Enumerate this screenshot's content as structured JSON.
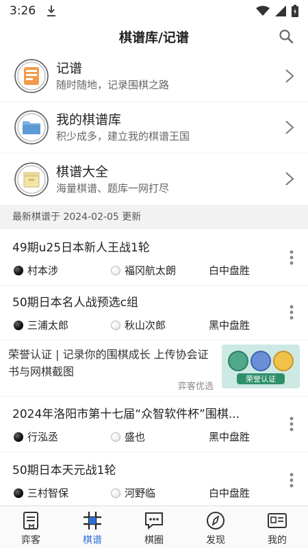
{
  "status_bar": {
    "time": "3:26"
  },
  "header": {
    "title": "棋谱库/记谱"
  },
  "menu": [
    {
      "title": "记谱",
      "subtitle": "随时随地，记录围棋之路"
    },
    {
      "title": "我的棋谱库",
      "subtitle": "积少成多，建立我的棋谱王国"
    },
    {
      "title": "棋谱大全",
      "subtitle": "海量棋谱、题库一网打尽"
    }
  ],
  "section": {
    "header": "最新棋谱于 2024-02-05 更新"
  },
  "games": [
    {
      "title": "49期u25日本新人王战1轮",
      "black": "村本涉",
      "white": "福冈航太朗",
      "result": "白中盘胜"
    },
    {
      "title": "50期日本名人战预选c组",
      "black": "三浦太郎",
      "white": "秋山次郎",
      "result": "黑中盘胜"
    },
    {
      "title": "2024年洛阳市第十七届“众智软件杯”围棋...",
      "black": "行泓丞",
      "white": "盛也",
      "result": "黑中盘胜"
    },
    {
      "title": "50期日本天元战1轮",
      "black": "三村智保",
      "white": "河野临",
      "result": "白中盘胜"
    }
  ],
  "ad": {
    "text": "荣誉认证 | 记录你的围棋成长 上传协会证书与网棋截图",
    "source": "弈客优选",
    "badge": "荣誉认证"
  },
  "tabs": [
    {
      "label": "弈客",
      "icon": "book-icon"
    },
    {
      "label": "棋谱",
      "icon": "board-icon",
      "active": true
    },
    {
      "label": "棋圈",
      "icon": "chat-icon"
    },
    {
      "label": "发现",
      "icon": "compass-icon"
    },
    {
      "label": "我的",
      "icon": "id-card-icon"
    }
  ],
  "colors": {
    "active_tab": "#2d6fd6",
    "section_bg": "#f2f2f2"
  }
}
